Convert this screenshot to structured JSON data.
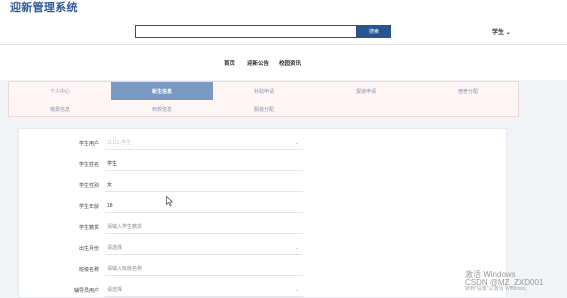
{
  "app": {
    "title": "迎新管理系统"
  },
  "search": {
    "placeholder": "",
    "button_label": "搜索"
  },
  "user_menu": {
    "label": "学生"
  },
  "nav": {
    "items": [
      {
        "label": "首页"
      },
      {
        "label": "迎新公告"
      },
      {
        "label": "校园资讯"
      }
    ]
  },
  "tabs": {
    "row1": [
      {
        "label": "个人中心"
      },
      {
        "label": "新生信息"
      },
      {
        "label": "补助申请"
      },
      {
        "label": "报道申请"
      },
      {
        "label": "宿舍分配"
      }
    ],
    "row2": [
      {
        "label": "缴费信息"
      },
      {
        "label": "到校信息"
      },
      {
        "label": "服装分配"
      }
    ]
  },
  "form": {
    "fields": [
      {
        "label": "学生用户",
        "value": "11111-学生",
        "kind": "select-disabled"
      },
      {
        "label": "学生姓名",
        "value": "学生",
        "kind": "text"
      },
      {
        "label": "学生性别",
        "value": "女",
        "kind": "text"
      },
      {
        "label": "学生年龄",
        "value": "18",
        "kind": "text"
      },
      {
        "label": "学生籍贯",
        "value": "请输入学生籍贯",
        "kind": "placeholder"
      },
      {
        "label": "出生月份",
        "value": "请选择",
        "kind": "select"
      },
      {
        "label": "班级名称",
        "value": "请输入班级名称",
        "kind": "placeholder"
      },
      {
        "label": "辅导员用户",
        "value": "请选择",
        "kind": "select"
      }
    ]
  },
  "watermark": {
    "line1": "激活 Windows",
    "line2": "CSDN @MZ_ZXD001",
    "line3": "转到\"设置\"以激活 Windows。"
  }
}
